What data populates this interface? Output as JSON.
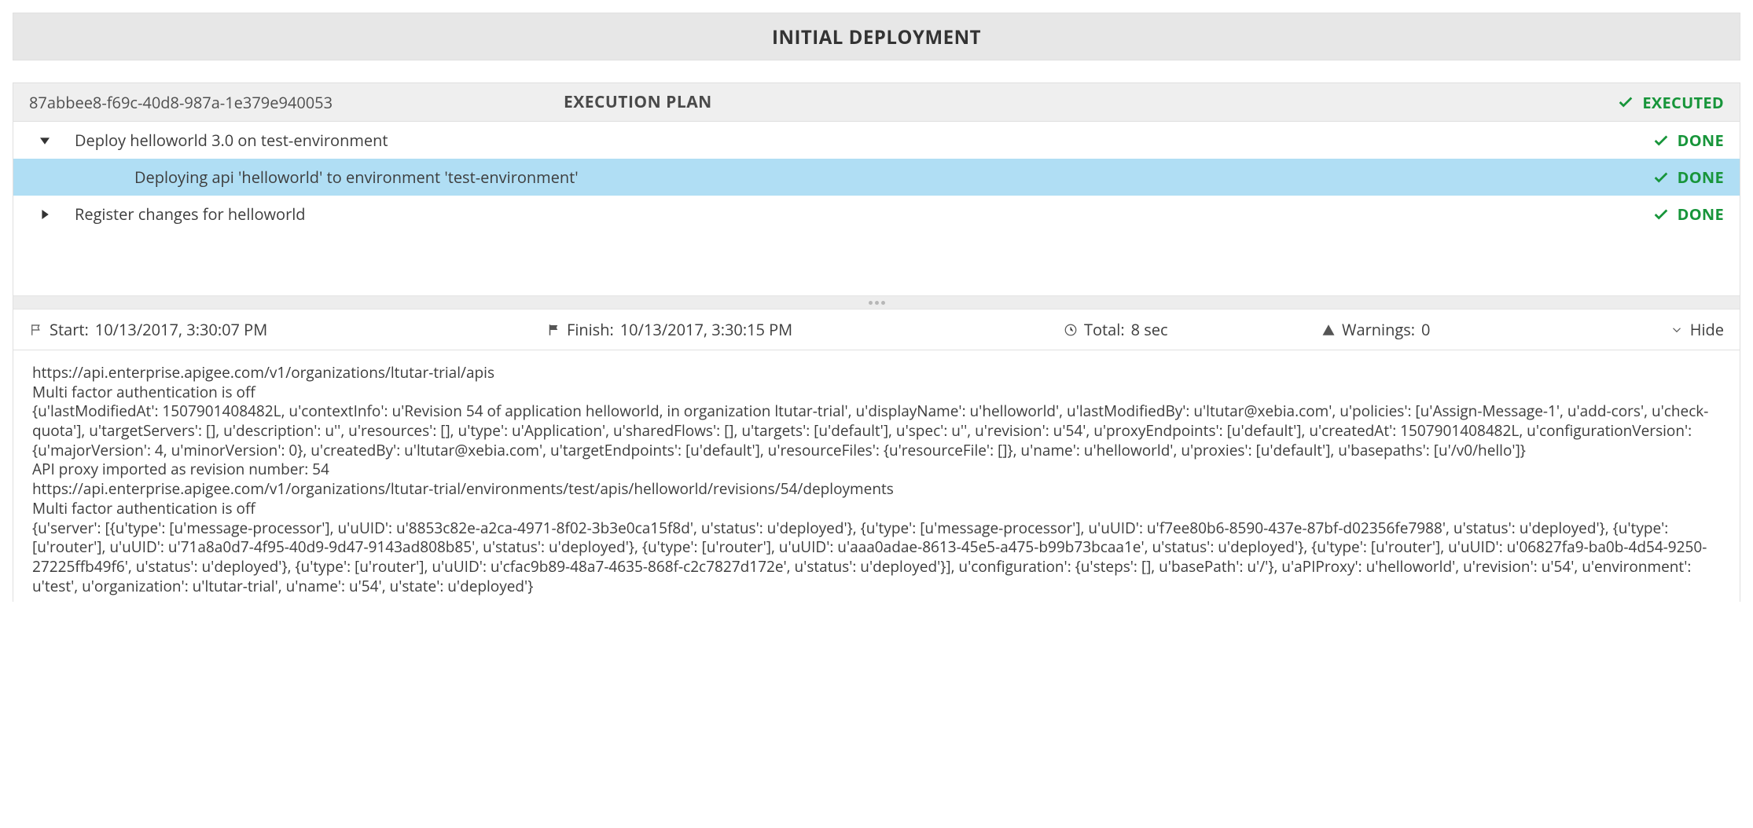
{
  "header": {
    "title": "INITIAL DEPLOYMENT"
  },
  "plan": {
    "uuid": "87abbee8-f69c-40d8-987a-1e379e940053",
    "title": "EXECUTION PLAN",
    "overall_status": "EXECUTED",
    "rows": [
      {
        "label": "Deploy helloworld 3.0 on test-environment",
        "status": "DONE"
      },
      {
        "label": "Deploying api 'helloworld' to environment 'test-environment'",
        "status": "DONE"
      },
      {
        "label": "Register changes for helloworld",
        "status": "DONE"
      }
    ]
  },
  "summary": {
    "start_label": "Start:",
    "start_value": "10/13/2017, 3:30:07 PM",
    "finish_label": "Finish:",
    "finish_value": "10/13/2017, 3:30:15 PM",
    "total_label": "Total:",
    "total_value": "8 sec",
    "warnings_label": "Warnings:",
    "warnings_value": "0",
    "hide_label": "Hide"
  },
  "log": "https://api.enterprise.apigee.com/v1/organizations/ltutar-trial/apis\nMulti factor authentication is off\n{u'lastModifiedAt': 1507901408482L, u'contextInfo': u'Revision 54 of application helloworld, in organization ltutar-trial', u'displayName': u'helloworld', u'lastModifiedBy': u'ltutar@xebia.com', u'policies': [u'Assign-Message-1', u'add-cors', u'check-quota'], u'targetServers': [], u'description': u'', u'resources': [], u'type': u'Application', u'sharedFlows': [], u'targets': [u'default'], u'spec': u'', u'revision': u'54', u'proxyEndpoints': [u'default'], u'createdAt': 1507901408482L, u'configurationVersion': {u'majorVersion': 4, u'minorVersion': 0}, u'createdBy': u'ltutar@xebia.com', u'targetEndpoints': [u'default'], u'resourceFiles': {u'resourceFile': []}, u'name': u'helloworld', u'proxies': [u'default'], u'basepaths': [u'/v0/hello']}\nAPI proxy imported as revision number: 54\nhttps://api.enterprise.apigee.com/v1/organizations/ltutar-trial/environments/test/apis/helloworld/revisions/54/deployments\nMulti factor authentication is off\n{u'server': [{u'type': [u'message-processor'], u'uUID': u'8853c82e-a2ca-4971-8f02-3b3e0ca15f8d', u'status': u'deployed'}, {u'type': [u'message-processor'], u'uUID': u'f7ee80b6-8590-437e-87bf-d02356fe7988', u'status': u'deployed'}, {u'type': [u'router'], u'uUID': u'71a8a0d7-4f95-40d9-9d47-9143ad808b85', u'status': u'deployed'}, {u'type': [u'router'], u'uUID': u'aaa0adae-8613-45e5-a475-b99b73bcaa1e', u'status': u'deployed'}, {u'type': [u'router'], u'uUID': u'06827fa9-ba0b-4d54-9250-27225ffb49f6', u'status': u'deployed'}, {u'type': [u'router'], u'uUID': u'cfac9b89-48a7-4635-868f-c2c7827d172e', u'status': u'deployed'}], u'configuration': {u'steps': [], u'basePath': u'/'}, u'aPIProxy': u'helloworld', u'revision': u'54', u'environment': u'test', u'organization': u'ltutar-trial', u'name': u'54', u'state': u'deployed'}"
}
